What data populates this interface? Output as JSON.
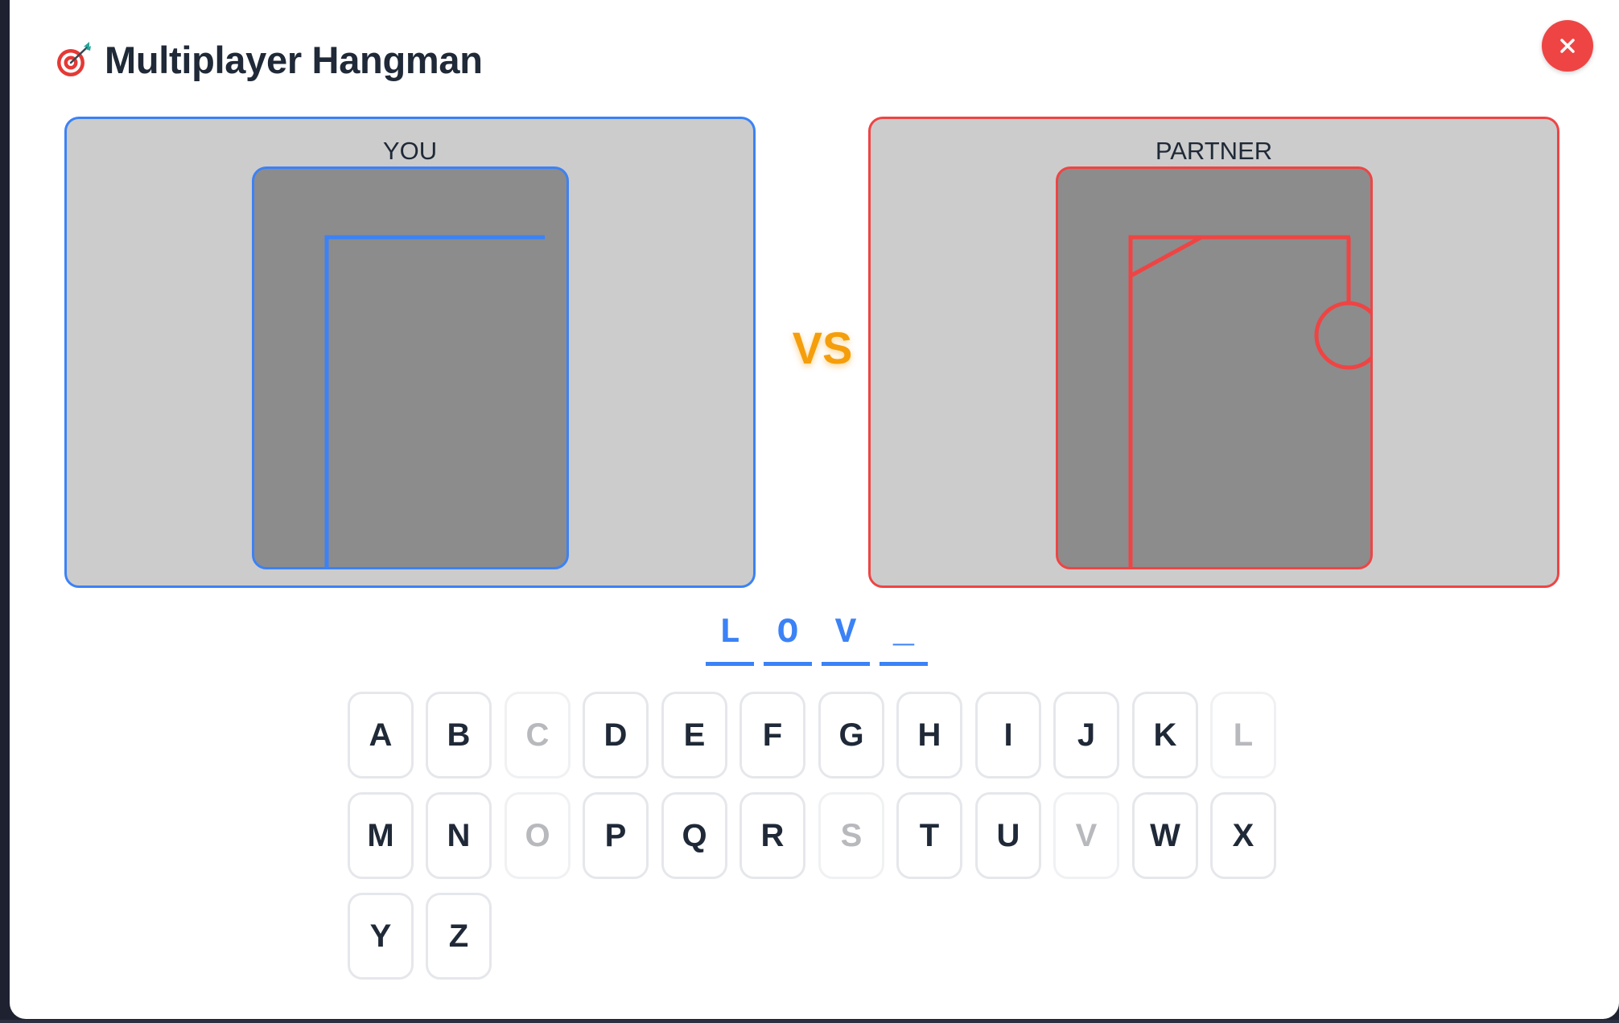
{
  "header": {
    "icon": "dart-target-icon",
    "title": "Multiplayer Hangman",
    "close_icon": "close-icon"
  },
  "players": {
    "you": {
      "label": "YOU",
      "color": "#3b82f6",
      "stage": 2
    },
    "partner": {
      "label": "PARTNER",
      "color": "#ef4444",
      "stage": 4
    }
  },
  "vs_label": "VS",
  "word": {
    "slots": [
      "L",
      "O",
      "V",
      "_"
    ]
  },
  "keyboard": {
    "keys": [
      {
        "letter": "A",
        "used": false
      },
      {
        "letter": "B",
        "used": false
      },
      {
        "letter": "C",
        "used": true
      },
      {
        "letter": "D",
        "used": false
      },
      {
        "letter": "E",
        "used": false
      },
      {
        "letter": "F",
        "used": false
      },
      {
        "letter": "G",
        "used": false
      },
      {
        "letter": "H",
        "used": false
      },
      {
        "letter": "I",
        "used": false
      },
      {
        "letter": "J",
        "used": false
      },
      {
        "letter": "K",
        "used": false
      },
      {
        "letter": "L",
        "used": true
      },
      {
        "letter": "M",
        "used": false
      },
      {
        "letter": "N",
        "used": false
      },
      {
        "letter": "O",
        "used": true
      },
      {
        "letter": "P",
        "used": false
      },
      {
        "letter": "Q",
        "used": false
      },
      {
        "letter": "R",
        "used": false
      },
      {
        "letter": "S",
        "used": true
      },
      {
        "letter": "T",
        "used": false
      },
      {
        "letter": "U",
        "used": false
      },
      {
        "letter": "V",
        "used": true
      },
      {
        "letter": "W",
        "used": false
      },
      {
        "letter": "X",
        "used": false
      },
      {
        "letter": "Y",
        "used": false
      },
      {
        "letter": "Z",
        "used": false
      }
    ]
  }
}
